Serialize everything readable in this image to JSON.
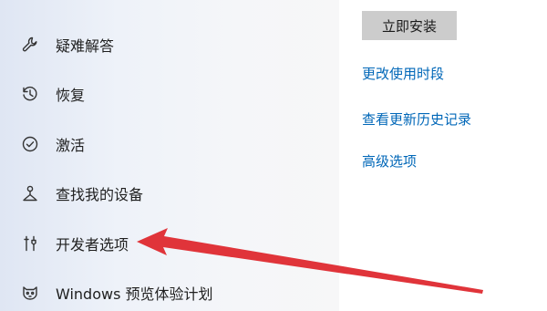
{
  "sidebar": {
    "items": [
      {
        "label": "疑难解答",
        "icon": "wrench-icon"
      },
      {
        "label": "恢复",
        "icon": "history-icon"
      },
      {
        "label": "激活",
        "icon": "check-circle-icon"
      },
      {
        "label": "查找我的设备",
        "icon": "person-location-icon"
      },
      {
        "label": "开发者选项",
        "icon": "developer-tools-icon"
      },
      {
        "label": "Windows 预览体验计划",
        "icon": "insider-cat-icon"
      }
    ]
  },
  "main": {
    "install_button_label": "立即安装",
    "links": [
      "更改使用时段",
      "查看更新历史记录",
      "高级选项"
    ]
  },
  "colors": {
    "link": "#0067b8",
    "arrow": "#e0343a",
    "button_bg": "#cccccc"
  }
}
